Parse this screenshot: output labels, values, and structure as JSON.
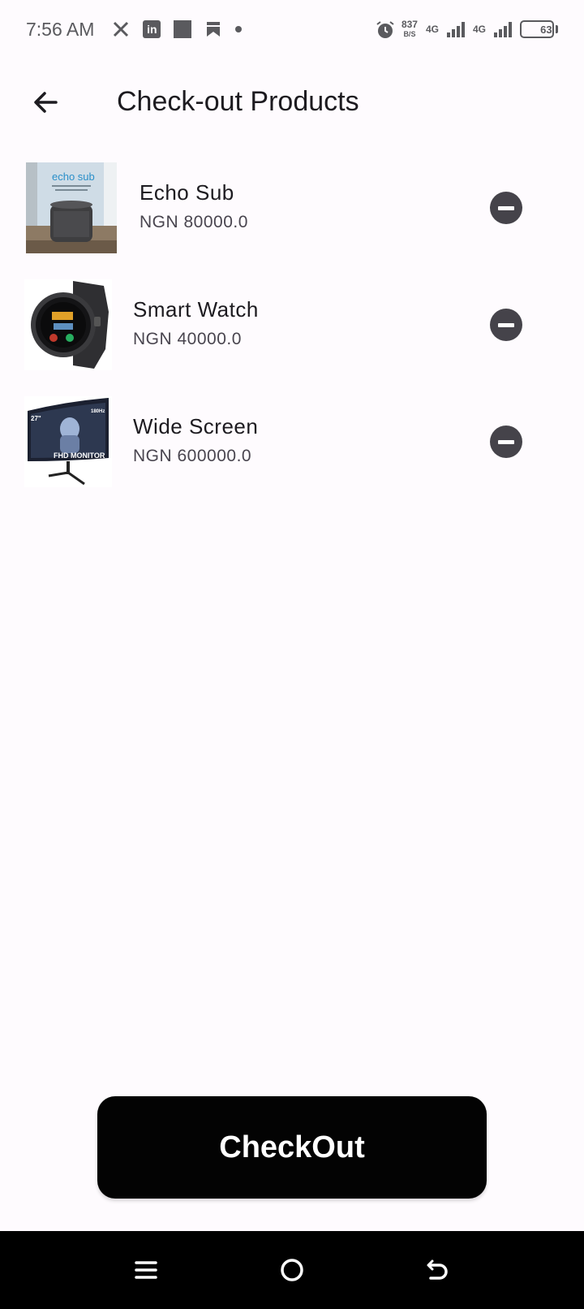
{
  "status_bar": {
    "time": "7:56 AM",
    "speed_value": "837",
    "speed_unit": "B/S",
    "network_1": "4G",
    "network_2": "4G",
    "battery": "63",
    "icons": [
      "x-icon",
      "linkedin-icon",
      "square-icon",
      "bookmark-icon",
      "dot-icon",
      "alarm-icon",
      "signal-icon",
      "battery-icon"
    ]
  },
  "app_bar": {
    "title": "Check-out Products",
    "back_icon": "arrow-left-icon"
  },
  "products": [
    {
      "name": "Echo Sub",
      "price": "NGN 80000.0",
      "image_text": "echo sub",
      "image_icon": "speaker-image"
    },
    {
      "name": "Smart Watch",
      "price": "NGN 40000.0",
      "image_icon": "smartwatch-image"
    },
    {
      "name": "Wide Screen",
      "price": "NGN 600000.0",
      "image_text_size": "27\"",
      "image_text_label": "FHD MONITOR",
      "image_text_hz": "180Hz",
      "image_icon": "monitor-image"
    }
  ],
  "remove_icon": "remove-circle-icon",
  "checkout": {
    "label": "CheckOut"
  },
  "nav_bar": {
    "icons": [
      "menu-icon",
      "home-circle-icon",
      "back-icon"
    ]
  },
  "colors": {
    "background": "#fefbfe",
    "button": "#030303",
    "remove": "#45434a",
    "text_primary": "#1d1b20",
    "text_secondary": "#49454f"
  }
}
